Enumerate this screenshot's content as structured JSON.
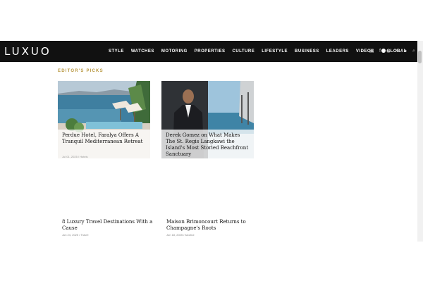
{
  "header": {
    "logo": "LUXUO",
    "menu": [
      "STYLE",
      "WATCHES",
      "MOTORING",
      "PROPERTIES",
      "CULTURE",
      "LIFESTYLE",
      "BUSINESS",
      "LEADERS",
      "VIDEOS"
    ],
    "global_label": "GLOBAL",
    "social_icons": [
      "linkedin-icon",
      "facebook-icon",
      "instagram-icon",
      "twitter-icon",
      "pinterest-icon",
      "search-icon"
    ]
  },
  "section": {
    "title": "EDITOR'S PICKS"
  },
  "featured": [
    {
      "title": "Perdue Hotel, Faralya Offers A Tranquil Mediterranean Retreat",
      "meta": "Jul 01, 2025 / Hotels"
    },
    {
      "title": "Derek Gomez on What Makes The St. Regis Langkawi the Island's Most Storied Beachfront Sanctuary",
      "meta": ""
    }
  ],
  "articles": [
    {
      "title": "8 Luxury Travel Destinations With a Cause",
      "meta": "Jun 24, 2025 / Travel"
    },
    {
      "title": "Maison Brimoncourt Returns to Champagne's Roots",
      "meta": "Jun 18, 2025 / Alcohol"
    }
  ],
  "colors": {
    "nav_bg": "#111111",
    "accent": "#b8973f"
  }
}
